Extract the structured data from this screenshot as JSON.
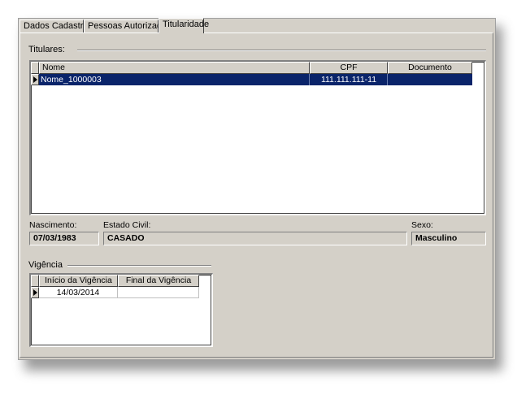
{
  "tabs": [
    {
      "label": "Dados Cadastrais"
    },
    {
      "label": "Pessoas Autorizadas"
    },
    {
      "label": "Titularidade"
    }
  ],
  "titulares": {
    "label": "Titulares:",
    "columns": [
      "Nome",
      "CPF",
      "Documento"
    ],
    "rows": [
      {
        "nome": "Nome_1000003",
        "cpf": "111.111.111-11",
        "documento": ""
      }
    ]
  },
  "nascimento": {
    "label": "Nascimento:",
    "value": "07/03/1983"
  },
  "estado_civil": {
    "label": "Estado Civil:",
    "value": "CASADO"
  },
  "sexo": {
    "label": "Sexo:",
    "value": "Masculino"
  },
  "vigencia": {
    "label": "Vigência",
    "columns": [
      "Início da Vigência",
      "Final da Vigência"
    ],
    "rows": [
      {
        "inicio": "14/03/2014",
        "final": ""
      }
    ]
  }
}
